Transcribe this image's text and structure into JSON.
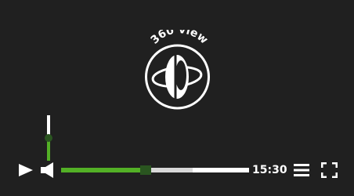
{
  "logo": {
    "label": "360 view",
    "icon": "360-view-icon"
  },
  "controls": {
    "play_icon": "play-icon",
    "volume_icon": "speaker-icon",
    "menu_icon": "menu-icon",
    "fullscreen_icon": "fullscreen-icon",
    "time": "15:30",
    "volume_level": 0.5,
    "progress_played": 0.45,
    "progress_buffered": 0.7
  },
  "colors": {
    "background": "#202020",
    "accent": "#53b026",
    "thumb": "#2a5520",
    "track": "#ffffff",
    "buffer": "#d8d8d8"
  }
}
